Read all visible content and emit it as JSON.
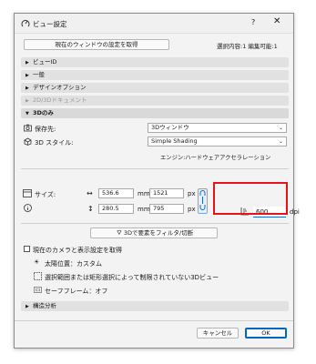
{
  "window": {
    "title": "ビュー設定",
    "help": "?",
    "close": "✕"
  },
  "top": {
    "get_current_settings": "現在のウィンドウの設定を取得",
    "selection_info": "選択内容:1 編集可能:1"
  },
  "sections": [
    {
      "label": "ビューID",
      "state": "collapsed"
    },
    {
      "label": "一般",
      "state": "collapsed"
    },
    {
      "label": "デザインオプション",
      "state": "collapsed"
    },
    {
      "label": "2D/3Dドキュメント",
      "state": "disabled"
    },
    {
      "label": "3Dのみ",
      "state": "expanded"
    }
  ],
  "three_d": {
    "save_to_label": "保存先:",
    "save_to_value": "3Dウィンドウ",
    "style_label": "3D スタイル:",
    "style_value": "Simple Shading",
    "engine": "エンジン:ハードウェアアクセラレーション"
  },
  "size": {
    "label": "サイズ:",
    "width": "536.6",
    "width_unit": "mm",
    "width_px": "1521",
    "width_px_unit": "px",
    "height": "280.5",
    "height_unit": "mm",
    "height_px": "795",
    "height_px_unit": "px",
    "dpi_value": "600",
    "dpi_unit": "dpi"
  },
  "filter_button": "3Dで要素をフィルタ/切断",
  "camera": {
    "checkbox_label": "現在のカメラと表示設定を取得",
    "sun": "太陽位置：カスタム",
    "limit": "選択範囲または矩形選択によって制限されていない3Dビュー",
    "safe_frame": "セーフフレーム：オフ"
  },
  "structural_analysis": "構造分析",
  "buttons": {
    "cancel": "キャンセル",
    "ok": "OK"
  },
  "colors": {
    "highlight": "#e8131a",
    "accent": "#0067c0"
  }
}
